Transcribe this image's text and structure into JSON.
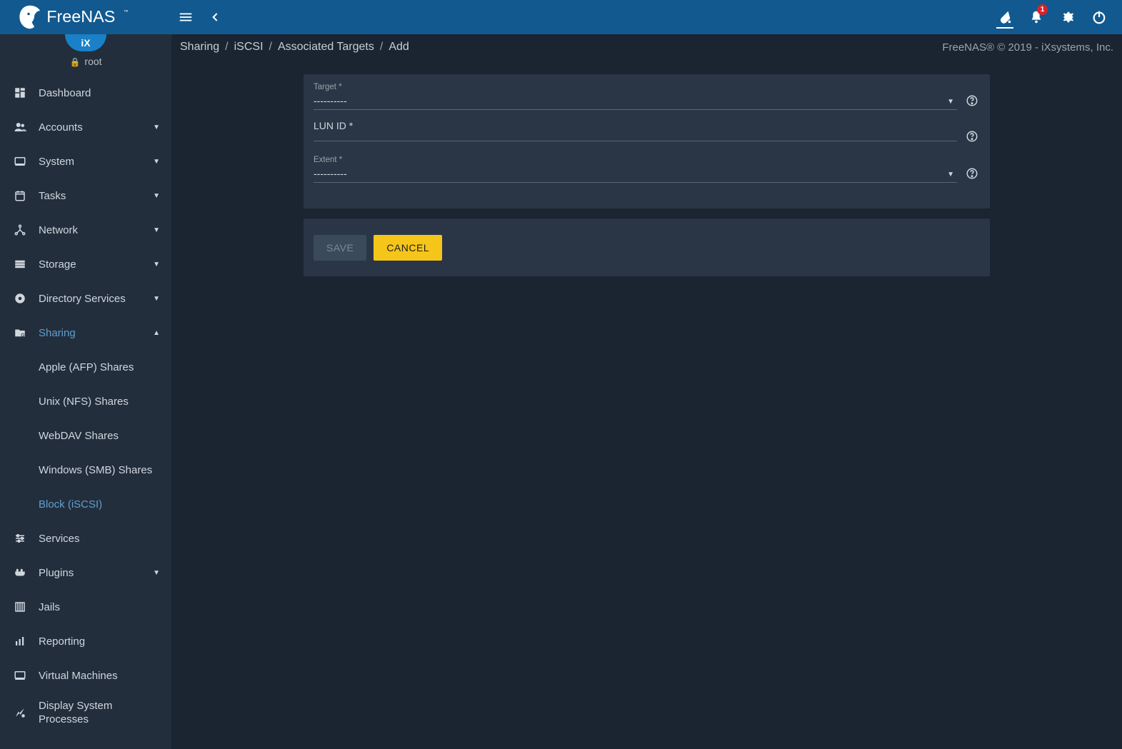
{
  "brand": "FreeNAS",
  "user": {
    "name": "root"
  },
  "topbar": {
    "notification_count": "1"
  },
  "sidebar": {
    "items": [
      {
        "label": "Dashboard"
      },
      {
        "label": "Accounts"
      },
      {
        "label": "System"
      },
      {
        "label": "Tasks"
      },
      {
        "label": "Network"
      },
      {
        "label": "Storage"
      },
      {
        "label": "Directory Services"
      },
      {
        "label": "Sharing",
        "children": [
          {
            "label": "Apple (AFP) Shares"
          },
          {
            "label": "Unix (NFS) Shares"
          },
          {
            "label": "WebDAV Shares"
          },
          {
            "label": "Windows (SMB) Shares"
          },
          {
            "label": "Block (iSCSI)"
          }
        ]
      },
      {
        "label": "Services"
      },
      {
        "label": "Plugins"
      },
      {
        "label": "Jails"
      },
      {
        "label": "Reporting"
      },
      {
        "label": "Virtual Machines"
      },
      {
        "label": "Display System Processes"
      }
    ]
  },
  "avatar_text": "iX",
  "breadcrumbs": [
    "Sharing",
    "iSCSI",
    "Associated Targets",
    "Add"
  ],
  "copyright": "FreeNAS® © 2019 - iXsystems, Inc.",
  "form": {
    "target": {
      "label": "Target *",
      "value": "----------"
    },
    "lun": {
      "label": "LUN ID *",
      "value": ""
    },
    "extent": {
      "label": "Extent *",
      "value": "----------"
    },
    "buttons": {
      "save": "SAVE",
      "cancel": "CANCEL"
    }
  }
}
